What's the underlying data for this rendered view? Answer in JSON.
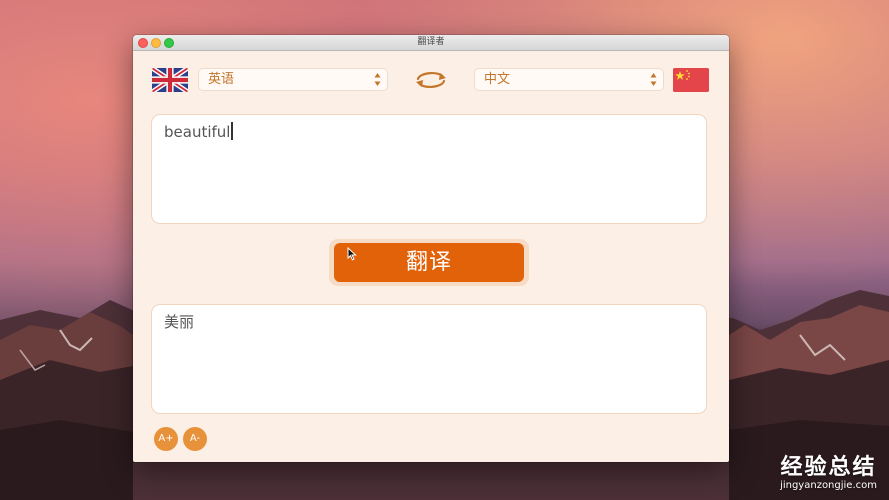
{
  "window": {
    "title": "翻译者"
  },
  "languages": {
    "source": {
      "label": "英语",
      "flag_icon": "uk-flag-icon"
    },
    "target": {
      "label": "中文",
      "flag_icon": "china-flag-icon"
    },
    "swap_icon": "swap-arrows-icon"
  },
  "input": {
    "text": "beautiful"
  },
  "actions": {
    "translate_label": "翻译"
  },
  "output": {
    "text": "美丽"
  },
  "font_controls": {
    "increase_label": "A+",
    "decrease_label": "A-"
  },
  "watermark": {
    "main": "经验总结",
    "url": "jingyanzongjie.com"
  },
  "colors": {
    "accent": "#e2620a",
    "label": "#c4762b",
    "font_button": "#e8913b",
    "window_bg": "#fbefe6"
  }
}
